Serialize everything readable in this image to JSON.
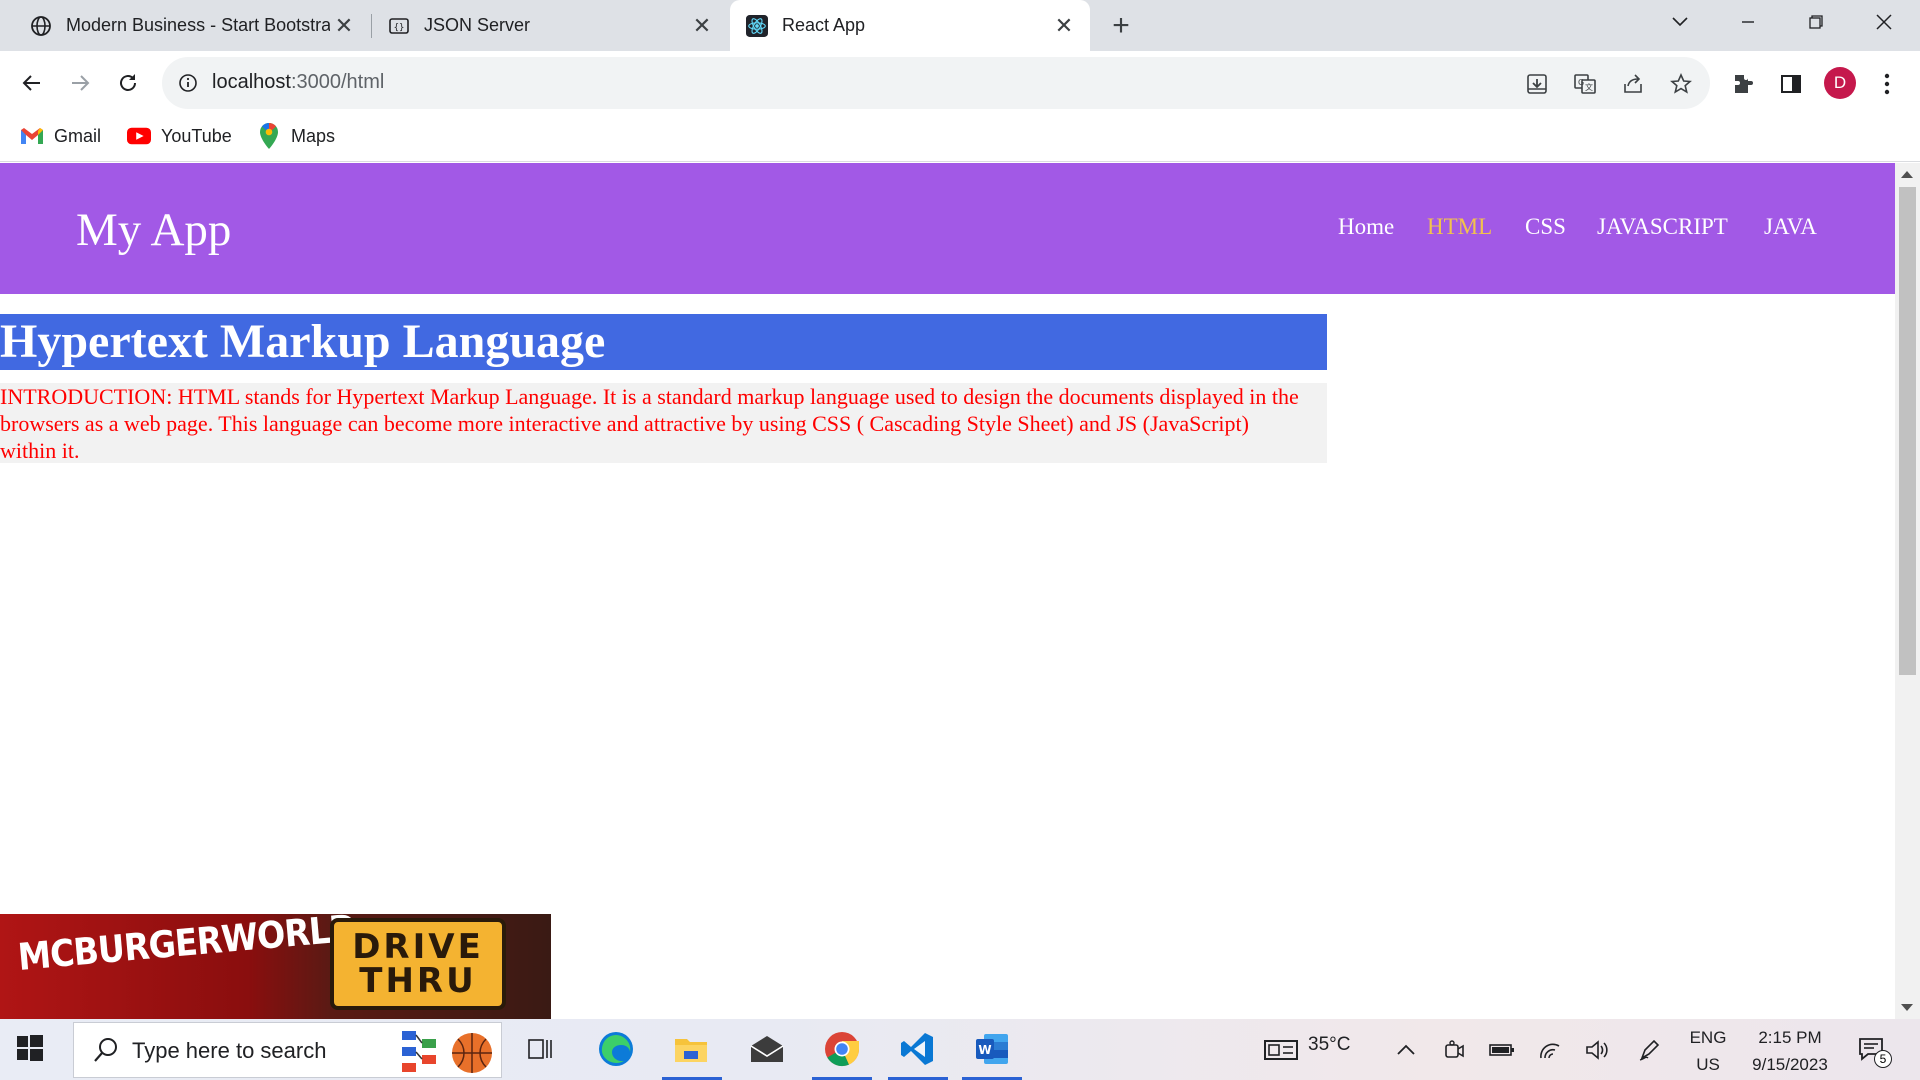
{
  "browser": {
    "tabs": [
      {
        "title": "Modern Business - Start Bootstrap",
        "favicon": "globe-icon",
        "active": false
      },
      {
        "title": "JSON Server",
        "favicon": "json-server-icon",
        "active": false
      },
      {
        "title": "React App",
        "favicon": "react-icon",
        "active": true
      }
    ],
    "new_tab_label": "+",
    "address": {
      "host": "localhost",
      "path": ":3000/html"
    },
    "profile_initial": "D",
    "bookmarks": [
      {
        "label": "Gmail",
        "icon": "gmail-icon"
      },
      {
        "label": "YouTube",
        "icon": "youtube-icon"
      },
      {
        "label": "Maps",
        "icon": "maps-icon"
      }
    ]
  },
  "app": {
    "brand": "My App",
    "nav": [
      {
        "label": "Home",
        "active": false
      },
      {
        "label": "HTML",
        "active": true
      },
      {
        "label": "CSS",
        "active": false
      },
      {
        "label": "JAVASCRIPT",
        "active": false
      },
      {
        "label": "JAVA",
        "active": false
      }
    ],
    "heading": "Hypertext Markup Language",
    "intro": "INTRODUCTION: HTML stands for Hypertext Markup Language. It is a standard markup language used to design the documents displayed in the browsers as a web page. This language can become more interactive and attractive by using CSS ( Cascading Style Sheet) and JS (JavaScript) within it."
  },
  "ad": {
    "logo": "MCBURGERWORLD",
    "sign_line1": "DRIVE",
    "sign_line2": "THRU"
  },
  "taskbar": {
    "search_placeholder": "Type here to search",
    "weather": "35°C",
    "lang_top": "ENG",
    "lang_bottom": "US",
    "time": "2:15 PM",
    "date": "9/15/2023",
    "notification_count": "5"
  },
  "colors": {
    "header_bg": "#a259e6",
    "nav_active": "#f2c24d",
    "heading_bg": "#4169e1",
    "intro_text": "#ff0000",
    "intro_bg": "#f2f2f2"
  }
}
